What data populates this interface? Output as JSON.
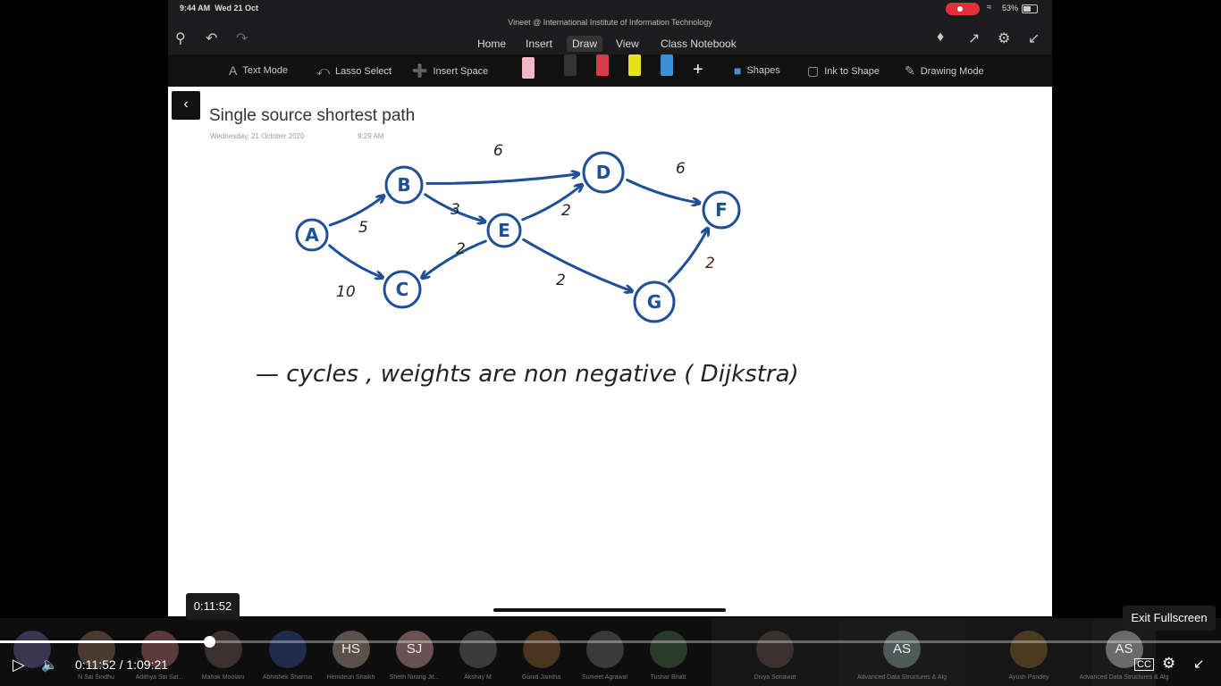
{
  "status_bar": {
    "time": "9:44 AM",
    "date": "Wed 21 Oct",
    "battery": "53%"
  },
  "document_title": "Vineet @ International Institute of Information Technology",
  "menu_tabs": [
    "Home",
    "Insert",
    "Draw",
    "View",
    "Class Notebook"
  ],
  "active_tab": "Draw",
  "tools": {
    "text_mode": "Text Mode",
    "lasso_select": "Lasso Select",
    "insert_space": "Insert Space",
    "shapes": "Shapes",
    "ink_to_shape": "Ink to Shape",
    "drawing_mode": "Drawing Mode"
  },
  "pen_colors": [
    "#f2b8c6",
    "#333333",
    "#d63b4b",
    "#e8e21c",
    "#3a8fd6"
  ],
  "page": {
    "title": "Single source shortest path",
    "date": "Wednesday, 21 October 2020",
    "time": "9:29 AM"
  },
  "graph": {
    "nodes": [
      "A",
      "B",
      "C",
      "D",
      "E",
      "F",
      "G"
    ],
    "edges": [
      {
        "from": "A",
        "to": "B",
        "weight": "5"
      },
      {
        "from": "A",
        "to": "C",
        "weight": "10"
      },
      {
        "from": "B",
        "to": "D",
        "weight": "6"
      },
      {
        "from": "B",
        "to": "E",
        "weight": "3"
      },
      {
        "from": "E",
        "to": "D",
        "weight": "2"
      },
      {
        "from": "E",
        "to": "C",
        "weight": "2"
      },
      {
        "from": "E",
        "to": "G",
        "weight": "2"
      },
      {
        "from": "D",
        "to": "F",
        "weight": "6"
      },
      {
        "from": "G",
        "to": "F",
        "weight": "2"
      }
    ]
  },
  "handwritten_note": "— cycles , weights are non negative ( Dijkstra)",
  "ink_color": "#1f4f96",
  "player": {
    "current_time": "0:11:52",
    "separator": "/",
    "duration": "1:09:21",
    "progress_fraction": 0.171,
    "hover_time": "0:11:52",
    "exit_tooltip": "Exit Fullscreen"
  },
  "participants": [
    {
      "initials": "",
      "name": ""
    },
    {
      "initials": "",
      "name": "N Sai Sindhu"
    },
    {
      "initials": "",
      "name": "Adithya Sai Sat..."
    },
    {
      "initials": "",
      "name": "Mahak Moolani"
    },
    {
      "initials": "",
      "name": "Abhishek Sharma"
    },
    {
      "initials": "HS",
      "name": "Hemdeun Shaikh"
    },
    {
      "initials": "SJ",
      "name": "Sheth Nirang Jit..."
    },
    {
      "initials": "",
      "name": "Akshay M"
    },
    {
      "initials": "",
      "name": "Gunid Jaintha"
    },
    {
      "initials": "",
      "name": "Sumeet Agrawal"
    },
    {
      "initials": "",
      "name": "Tushar Bhatt"
    },
    {
      "initials": "",
      "name": "Divya Sonawat"
    },
    {
      "initials": "AS",
      "name": "Advanced Data Structures & Algorit..."
    },
    {
      "initials": "",
      "name": "Ayush Pandey"
    },
    {
      "initials": "AS",
      "name": "Advanced Data Structures & Algori..."
    }
  ]
}
